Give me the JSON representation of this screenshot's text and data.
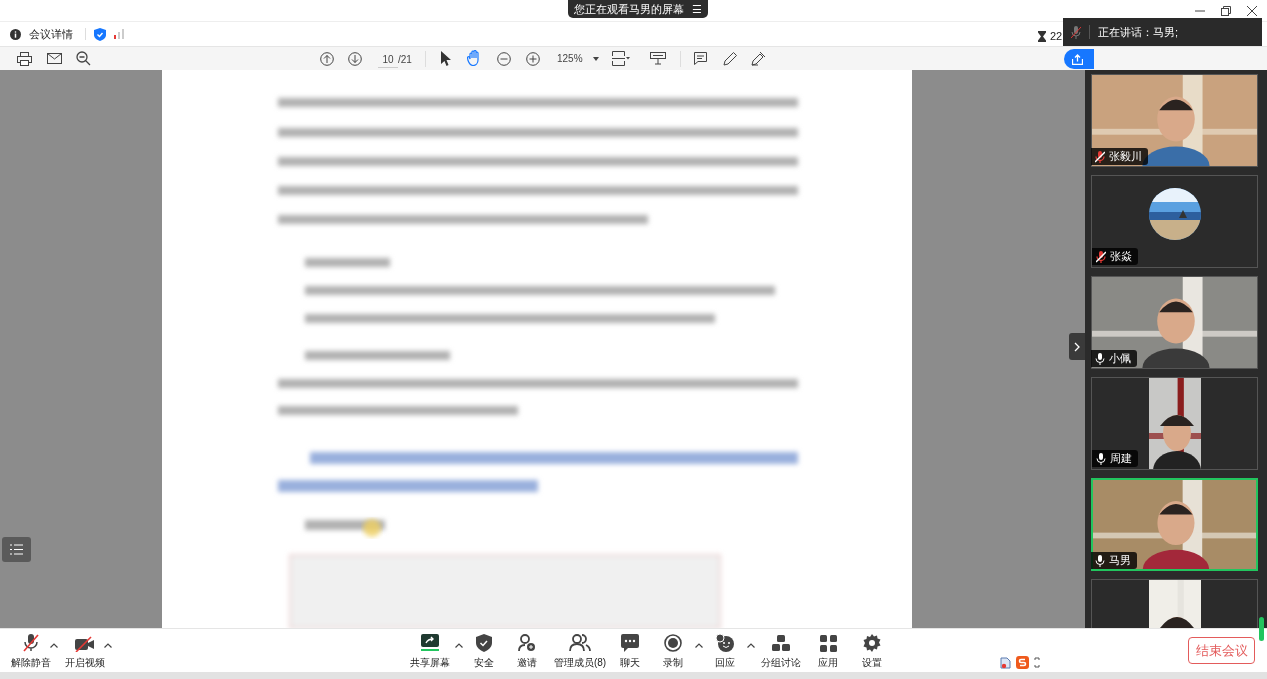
{
  "banner": {
    "text": "您正在观看马男的屏幕",
    "icon_text": "☰"
  },
  "info_bar": {
    "details": "会议详情",
    "timer": "22"
  },
  "speaker_bar": {
    "text": "正在讲话：马男;"
  },
  "pdf_toolbar": {
    "page": "10",
    "total": "/21",
    "zoom": "125%"
  },
  "participants": [
    {
      "name": "张毅川",
      "kind": "video",
      "muted": true,
      "selected": false
    },
    {
      "name": "张焱",
      "kind": "avatar",
      "muted": true,
      "selected": false
    },
    {
      "name": "小佩",
      "kind": "video",
      "muted": false,
      "selected": false
    },
    {
      "name": "周建",
      "kind": "video",
      "muted": false,
      "selected": false
    },
    {
      "name": "马男",
      "kind": "video",
      "muted": false,
      "selected": true
    },
    {
      "kind": "video",
      "selected": false
    }
  ],
  "toolbar_left": [
    {
      "label": "解除静音",
      "kind": "mic-off"
    },
    {
      "label": "开启视频",
      "kind": "cam-off"
    }
  ],
  "toolbar_center": [
    {
      "label": "共享屏幕",
      "kind": "share",
      "caret": true
    },
    {
      "label": "安全",
      "kind": "shield",
      "caret": false
    },
    {
      "label": "邀请",
      "kind": "invite",
      "caret": false
    },
    {
      "label": "管理成员(8)",
      "kind": "members",
      "caret": false
    },
    {
      "label": "聊天",
      "kind": "chat",
      "caret": false
    },
    {
      "label": "录制",
      "kind": "record",
      "caret": true
    },
    {
      "label": "回应",
      "kind": "react",
      "caret": true
    },
    {
      "label": "分组讨论",
      "kind": "groups",
      "caret": false
    },
    {
      "label": "应用",
      "kind": "apps",
      "caret": false
    },
    {
      "label": "设置",
      "kind": "gear",
      "caret": false
    }
  ],
  "end_button": "结束会议"
}
